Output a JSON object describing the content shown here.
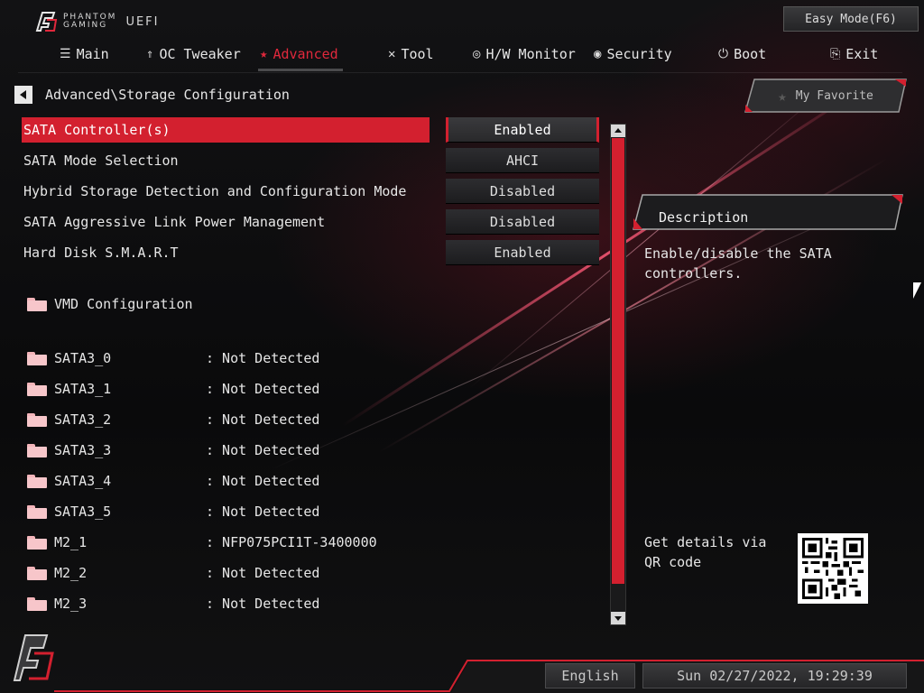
{
  "brand": {
    "line1": "PHANTOM",
    "line2": "GAMING",
    "uefi": "UEFI"
  },
  "top": {
    "easy_mode": "Easy Mode(F6)"
  },
  "nav": [
    {
      "label": "Main",
      "icon": "list-icon",
      "glyph": "☰",
      "active": false
    },
    {
      "label": "OC Tweaker",
      "icon": "rocket-icon",
      "glyph": "🚀",
      "active": false
    },
    {
      "label": "Advanced",
      "icon": "star-icon",
      "glyph": "★",
      "active": true
    },
    {
      "label": "Tool",
      "icon": "tool-icon",
      "glyph": "✕",
      "active": false
    },
    {
      "label": "H/W Monitor",
      "icon": "monitor-icon",
      "glyph": "◎",
      "active": false
    },
    {
      "label": "Security",
      "icon": "shield-icon",
      "glyph": "◉",
      "active": false
    },
    {
      "label": "Boot",
      "icon": "power-icon",
      "glyph": "⏻",
      "active": false
    },
    {
      "label": "Exit",
      "icon": "exit-icon",
      "glyph": "⎘",
      "active": false
    }
  ],
  "breadcrumb": "Advanced\\Storage Configuration",
  "settings": [
    {
      "label": "SATA Controller(s)",
      "value": "Enabled",
      "selected": true
    },
    {
      "label": "SATA Mode Selection",
      "value": "AHCI",
      "selected": false
    },
    {
      "label": "Hybrid Storage Detection and Configuration Mode",
      "value": "Disabled",
      "selected": false
    },
    {
      "label": "SATA Aggressive Link Power Management",
      "value": "Disabled",
      "selected": false
    },
    {
      "label": "Hard Disk S.M.A.R.T",
      "value": "Enabled",
      "selected": false
    }
  ],
  "submenu": {
    "label": "VMD Configuration"
  },
  "devices": [
    {
      "name": "SATA3_0",
      "value": ": Not Detected"
    },
    {
      "name": "SATA3_1",
      "value": ": Not Detected"
    },
    {
      "name": "SATA3_2",
      "value": ": Not Detected"
    },
    {
      "name": "SATA3_3",
      "value": ": Not Detected"
    },
    {
      "name": "SATA3_4",
      "value": ": Not Detected"
    },
    {
      "name": "SATA3_5",
      "value": ": Not Detected"
    },
    {
      "name": "M2_1",
      "value": ": NFP075PCI1T-3400000"
    },
    {
      "name": "M2_2",
      "value": ": Not Detected"
    },
    {
      "name": "M2_3",
      "value": ": Not Detected"
    }
  ],
  "right_panel": {
    "favorite": "My Favorite",
    "description_title": "Description",
    "description_text": "Enable/disable the SATA controllers.",
    "qr_text": "Get details via QR code"
  },
  "footer": {
    "language": "English",
    "datetime": "Sun 02/27/2022, 19:29:39"
  },
  "colors": {
    "accent": "#d3202f",
    "text": "#e6e6e6",
    "bg": "#0b0b0c"
  }
}
